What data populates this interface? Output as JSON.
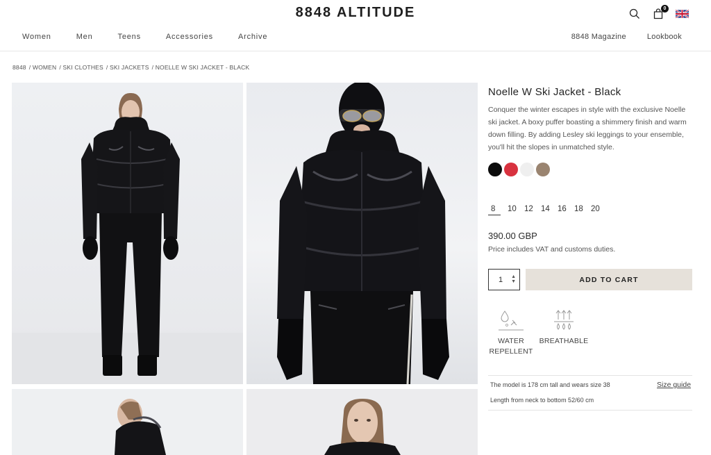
{
  "header": {
    "logo": "8848 ALTITUDE",
    "nav_left": [
      "Women",
      "Men",
      "Teens",
      "Accessories",
      "Archive"
    ],
    "nav_right": [
      "8848 Magazine",
      "Lookbook"
    ],
    "cart_count": "0",
    "icons": [
      "search-icon",
      "cart-icon",
      "uk-flag-icon"
    ]
  },
  "breadcrumb": [
    "8848",
    "/ WOMEN",
    "/ SKI CLOTHES",
    "/ SKI JACKETS",
    "/ NOELLE W SKI JACKET - BLACK"
  ],
  "product": {
    "title": "Noelle W Ski Jacket - Black",
    "description": "Conquer the winter escapes in style with the exclusive Noelle ski jacket. A boxy puffer boasting a shimmery finish and warm down filling. By adding Lesley ski leggings to your ensemble, you'll hit the slopes in unmatched style.",
    "colors": [
      "#0c0c0c",
      "#d8323f",
      "#efefef",
      "#9a8470"
    ],
    "sizes": [
      "8",
      "10",
      "12",
      "14",
      "16",
      "18",
      "20"
    ],
    "selected_size": "8",
    "price": "390.00 GBP",
    "vat_note": "Price includes VAT and customs duties.",
    "quantity": "1",
    "add_to_cart": "ADD TO CART",
    "features": [
      {
        "icon": "water-repellent-icon",
        "label_1": "WATER",
        "label_2": "REPELLENT"
      },
      {
        "icon": "breathable-icon",
        "label_1": "BREATHABLE",
        "label_2": ""
      }
    ],
    "model_info": "The model is 178 cm tall and wears size 38",
    "size_guide": "Size guide",
    "length_info": "Length from neck to bottom 52/60 cm"
  }
}
